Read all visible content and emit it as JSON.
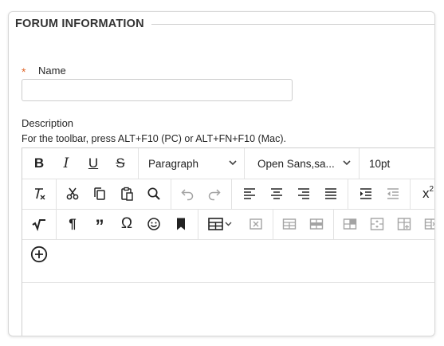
{
  "section": {
    "title": "FORUM INFORMATION"
  },
  "name_field": {
    "required_marker": "*",
    "label": "Name",
    "value": ""
  },
  "description": {
    "label": "Description",
    "toolbar_hint": "For the toolbar, press ALT+F10 (PC) or ALT+FN+F10 (Mac)."
  },
  "editor": {
    "block_format": "Paragraph",
    "font_family": "Open Sans,sa...",
    "font_size": "10pt",
    "superscript_glyph": "x",
    "superscript_exp": "2",
    "row1_buttons": [
      "bold-icon",
      "italic-icon",
      "underline-icon",
      "strikethrough-icon"
    ],
    "row2_buttons": [
      "clear-formatting-icon",
      "cut-icon",
      "copy-icon",
      "paste-icon",
      "find-icon",
      "undo-icon",
      "redo-icon",
      "align-left-icon",
      "align-center-icon",
      "align-right-icon",
      "justify-icon",
      "indent-icon",
      "outdent-icon",
      "superscript-icon"
    ],
    "row3_buttons": [
      "math-icon",
      "paragraph-mark-icon",
      "blockquote-icon",
      "omega-icon",
      "emoji-icon",
      "bookmark-icon",
      "table-icon",
      "delete-table-icon",
      "row-insert-before-icon",
      "row-insert-after-icon",
      "cell-props-icon",
      "merge-cells-icon",
      "split-cells-icon",
      "delete-column-icon"
    ],
    "row4_buttons": [
      "add-content-icon"
    ]
  },
  "colors": {
    "accent": "#e0662a",
    "border": "#cfcfcf",
    "icon": "#222222",
    "icon_disabled": "#a3a3a3"
  }
}
